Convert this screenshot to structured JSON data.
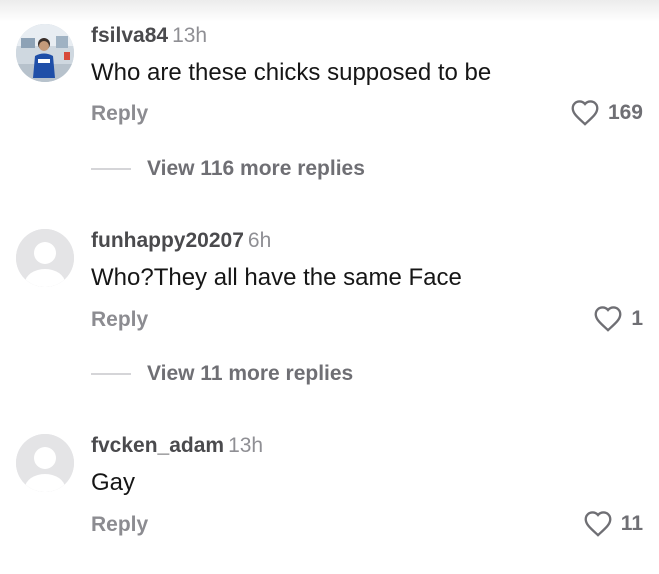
{
  "comments": [
    {
      "username": "fsilva84",
      "time": "13h",
      "text": "Who are these chicks supposed to be",
      "reply_label": "Reply",
      "likes": "169",
      "view_replies": "View 116 more replies",
      "avatar_icon": "profile-photo"
    },
    {
      "username": "funhappy20207",
      "time": "6h",
      "text": "Who?They all have the same Face",
      "reply_label": "Reply",
      "likes": "1",
      "view_replies": "View 11 more replies",
      "avatar_icon": "default-avatar-icon"
    },
    {
      "username": "fvcken_adam",
      "time": "13h",
      "text": "Gay",
      "reply_label": "Reply",
      "likes": "11",
      "avatar_icon": "default-avatar-icon"
    }
  ],
  "colors": {
    "username": "#4a4a4d",
    "timestamp": "#8f8f94",
    "body_text": "#161616",
    "secondary": "#8c8c91",
    "heart_outline": "#6f6f74"
  }
}
